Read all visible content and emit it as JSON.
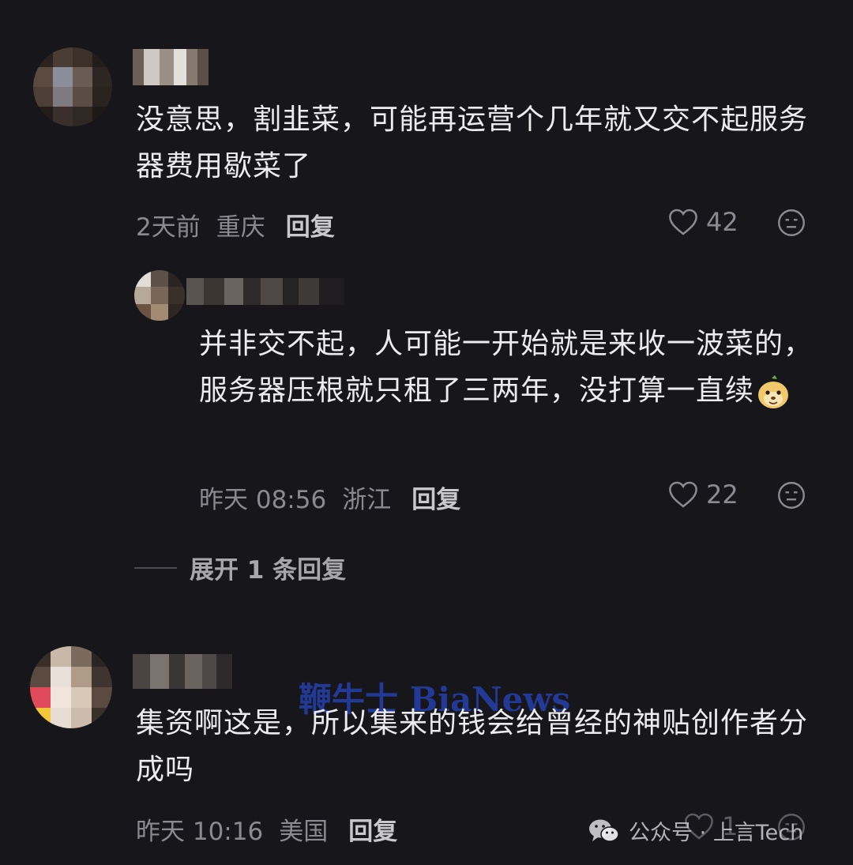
{
  "comments": [
    {
      "text": "没意思，割韭菜，可能再运营个几年就又交不起服务器费用歇菜了",
      "time": "2天前",
      "location": "重庆",
      "reply_label": "回复",
      "likes": "42"
    },
    {
      "text": "并非交不起，人可能一开始就是来收一波菜的，服务器压根就只租了三两年，没打算一直续",
      "time": "昨天 08:56",
      "location": "浙江",
      "reply_label": "回复",
      "likes": "22"
    },
    {
      "text": "集资啊这是，所以集来的钱会给曾经的神贴创作者分成吗",
      "time": "昨天 10:16",
      "location": "美国",
      "reply_label": "回复",
      "likes": "1"
    }
  ],
  "expand_replies": "展开 1 条回复",
  "watermark": "鞭牛士 BiaNews",
  "wechat_account": "公众号 · 上言Tech",
  "colors": {
    "background": "#17161b",
    "text": "#ececee",
    "meta": "#8a8a90",
    "watermark": "#2440aa"
  },
  "icons": [
    "heart-icon",
    "dislike-face-icon",
    "emoji-sticker-icon",
    "wechat-icon"
  ]
}
